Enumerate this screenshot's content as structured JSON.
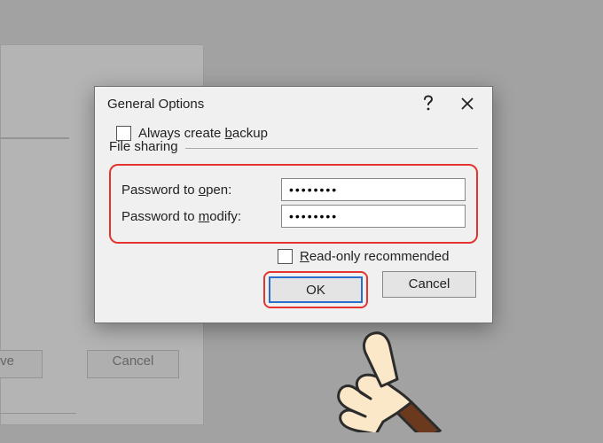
{
  "background": {
    "save_label": "ve",
    "cancel_label": "Cancel"
  },
  "dialog": {
    "title": "General Options",
    "always_backup": {
      "label_pre": "Always create ",
      "label_u": "b",
      "label_post": "ackup",
      "checked": false
    },
    "fieldset_legend": "File sharing",
    "pw_open": {
      "label_pre": "Password to ",
      "label_u": "o",
      "label_post": "pen:",
      "value": "••••••••"
    },
    "pw_modify": {
      "label_pre": "Password to ",
      "label_u": "m",
      "label_post": "odify:",
      "value": "••••••••"
    },
    "read_only": {
      "label_pre": "",
      "label_u": "R",
      "label_post": "ead-only recommended",
      "checked": false
    },
    "ok_label": "OK",
    "cancel_label": "Cancel"
  }
}
